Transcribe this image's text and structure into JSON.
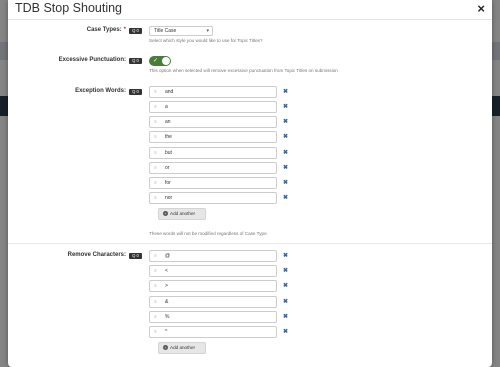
{
  "modal": {
    "title": "TDB Stop Shouting",
    "close": "×"
  },
  "case_types": {
    "label": "Case Types:",
    "required_mark": "*",
    "badge": "Q 0",
    "selected": "Title Case",
    "help": "Select which style you would like to use for Topic Titles?"
  },
  "excessive_punctuation": {
    "label": "Excessive Punctuation:",
    "badge": "Q 0",
    "enabled": true,
    "help": "This option when selected will remove excessive punctuation from Topic Titles on submission"
  },
  "exception_words": {
    "label": "Exception Words:",
    "badge": "Q 0",
    "values": [
      "and",
      "a",
      "an",
      "the",
      "but",
      "or",
      "for",
      "nor"
    ],
    "add_label": "Add another",
    "help": "These words will not be modified regardless of Case Type."
  },
  "remove_characters": {
    "label": "Remove Characters:",
    "badge": "Q 0",
    "values": [
      "@",
      "<",
      ">",
      "&",
      "%",
      "^"
    ],
    "add_label": "Add another"
  }
}
